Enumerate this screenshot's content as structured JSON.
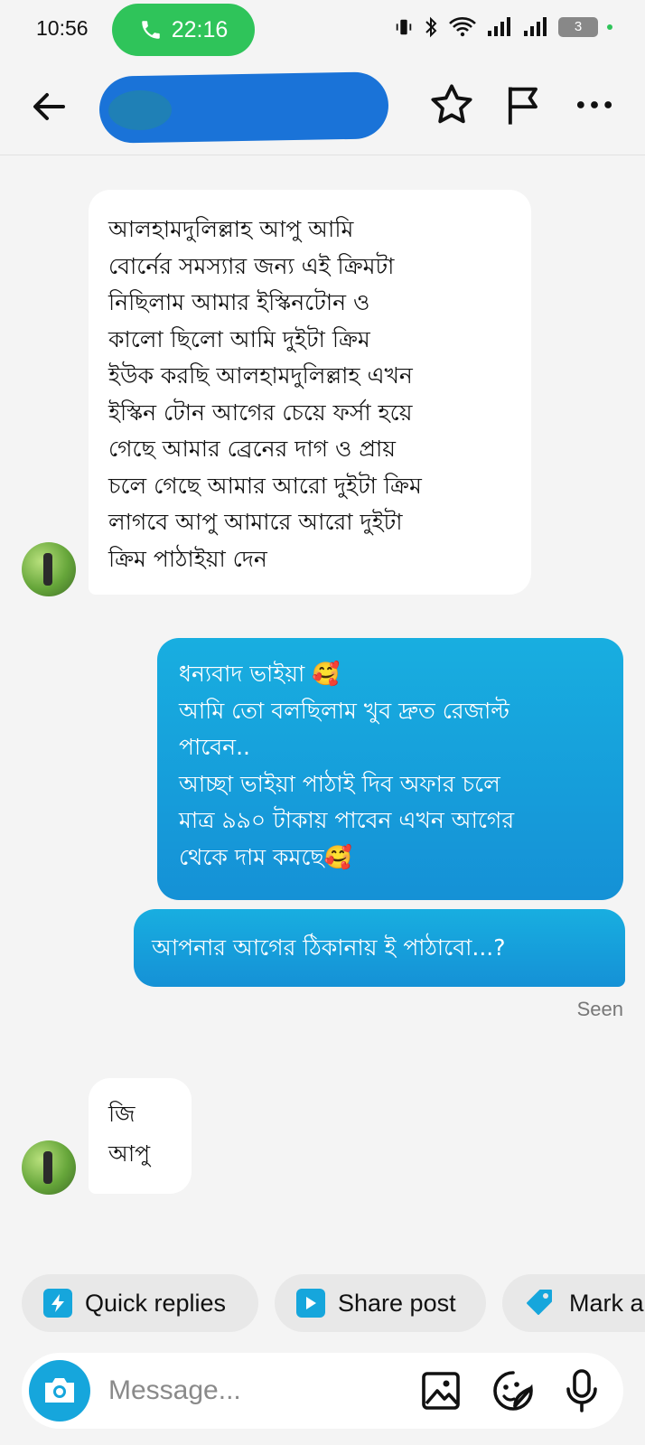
{
  "status_bar": {
    "time": "10:56",
    "call_timer": "22:16",
    "battery": "3"
  },
  "header": {
    "contact_name": ""
  },
  "messages": {
    "m1": {
      "lines": [
        "আলহামদুলিল্লাহ আপু আমি",
        "বোর্নের সমস্যার জন্য এই ক্রিমটা",
        "নিছিলাম আমার ইস্কিনটোন ও",
        "কালো ছিলো আমি দুইটা ক্রিম",
        "ইউক করছি আলহামদুলিল্লাহ এখন",
        "ইস্কিন টোন আগের চেয়ে ফর্সা হয়ে",
        "গেছে আমার ব্রেনের দাগ ও প্রায়",
        "চলে গেছে আমার আরো দুইটা ক্রিম",
        "লাগবে আপু আমারে আরো দুইটা",
        "ক্রিম পাঠাইয়া দেন"
      ]
    },
    "m2": {
      "lines": [
        "ধন্যবাদ ভাইয়া 🥰",
        "আমি তো বলছিলাম খুব দ্রুত রেজাল্ট",
        "পাবেন..",
        "আচ্ছা ভাইয়া পাঠাই দিব অফার চলে",
        "মাত্র ৯৯০ টাকায় পাবেন এখন আগের",
        "থেকে দাম কমছে🥰"
      ]
    },
    "m3": {
      "text": "আপনার আগের ঠিকানায় ই পাঠাবো...?"
    },
    "seen": "Seen",
    "m4": {
      "lines": [
        "জি",
        "আপু"
      ]
    }
  },
  "quick_actions": {
    "quick_replies": "Quick replies",
    "share_post": "Share post",
    "mark": "Mark a"
  },
  "composer": {
    "placeholder": "Message..."
  },
  "colors": {
    "accent": "#16a6dc",
    "call_green": "#2fc45a",
    "outgoing_bubble": "#1591d6"
  }
}
